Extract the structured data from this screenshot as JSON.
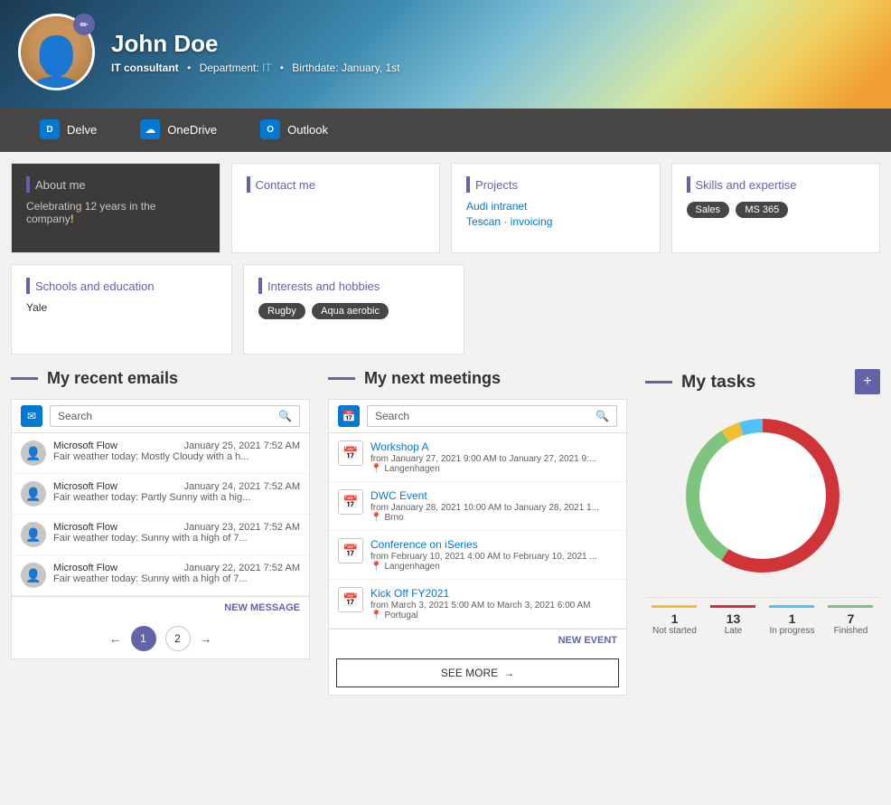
{
  "profile": {
    "name": "John Doe",
    "title": "IT consultant",
    "department_label": "Department:",
    "department": "IT",
    "birthdate_label": "Birthdate:",
    "birthdate": "January, 1st",
    "edit_icon": "✏"
  },
  "nav": {
    "items": [
      {
        "id": "delve",
        "label": "Delve",
        "icon": "D"
      },
      {
        "id": "onedrive",
        "label": "OneDrive",
        "icon": "☁"
      },
      {
        "id": "outlook",
        "label": "Outlook",
        "icon": "O"
      }
    ]
  },
  "cards": {
    "about": {
      "title": "About me",
      "body": "Celebrating 12 years in the company",
      "exclamation": "!"
    },
    "contact": {
      "title": "Contact me"
    },
    "projects": {
      "title": "Projects",
      "items": [
        "Audi intranet",
        "Tescan · invoicing"
      ]
    },
    "skills": {
      "title": "Skills and expertise",
      "tags": [
        "Sales",
        "MS 365"
      ]
    },
    "schools": {
      "title": "Schools and education",
      "value": "Yale"
    },
    "interests": {
      "title": "Interests and hobbies",
      "tags": [
        "Rugby",
        "Aqua aerobic"
      ]
    }
  },
  "emails": {
    "section_title": "My recent emails",
    "search_placeholder": "Search",
    "new_message_label": "NEW MESSAGE",
    "items": [
      {
        "from": "Microsoft Flow",
        "date": "January 25, 2021 7:52 AM",
        "subject": "Fair weather today: Mostly Cloudy with a h..."
      },
      {
        "from": "Microsoft Flow",
        "date": "January 24, 2021 7:52 AM",
        "subject": "Fair weather today: Partly Sunny with a hig..."
      },
      {
        "from": "Microsoft Flow",
        "date": "January 23, 2021 7:52 AM",
        "subject": "Fair weather today: Sunny with a high of 7..."
      },
      {
        "from": "Microsoft Flow",
        "date": "January 22, 2021 7:52 AM",
        "subject": "Fair weather today: Sunny with a high of 7..."
      }
    ],
    "pages": [
      "1",
      "2"
    ]
  },
  "meetings": {
    "section_title": "My next meetings",
    "search_placeholder": "Search",
    "new_event_label": "NEW EVENT",
    "see_more_label": "SEE MORE",
    "items": [
      {
        "title": "Workshop A",
        "time": "from January 27, 2021 9:00 AM  to January 27, 2021 9:...",
        "location": "Langenhagen"
      },
      {
        "title": "DWC Event",
        "time": "from January 28, 2021 10:00 AM  to January 28, 2021 1...",
        "location": "Brno"
      },
      {
        "title": "Conference on iSeries",
        "time": "from February 10, 2021 4:00 AM  to February 10, 2021 ...",
        "location": "Langenhagen"
      },
      {
        "title": "Kick Off FY2021",
        "time": "from March 3, 2021 5:00 AM  to March 3, 2021 6:00 AM",
        "location": "Portugal"
      }
    ]
  },
  "tasks": {
    "section_title": "My tasks",
    "add_label": "+",
    "legend": [
      {
        "count": "1",
        "label": "Not started",
        "color": "#f0c030"
      },
      {
        "count": "13",
        "label": "Late",
        "color": "#d13438"
      },
      {
        "count": "1",
        "label": "In progress",
        "color": "#4fc3f7"
      },
      {
        "count": "7",
        "label": "Finished",
        "color": "#7dc57e"
      }
    ],
    "donut": {
      "not_started_pct": 4,
      "late_pct": 59,
      "in_progress_pct": 5,
      "finished_pct": 32
    }
  }
}
